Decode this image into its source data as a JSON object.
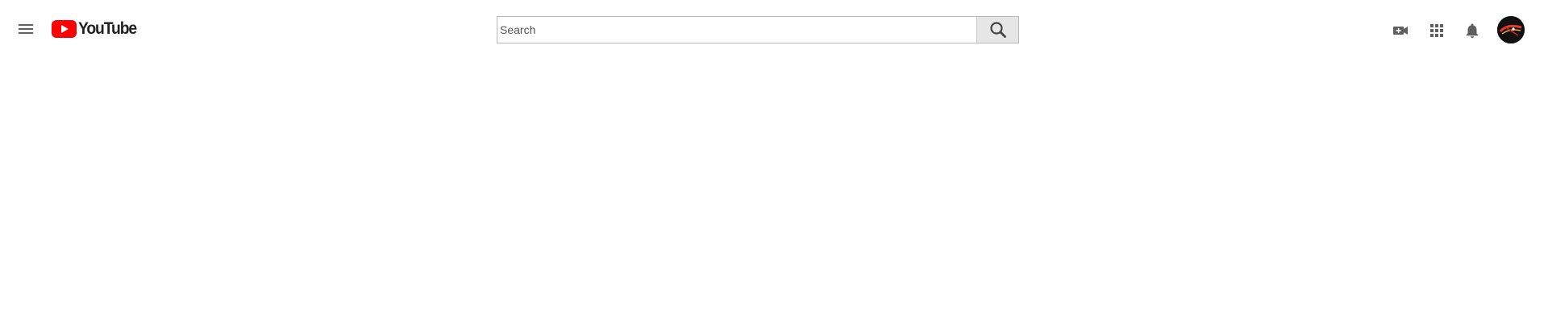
{
  "masthead": {
    "menu_icon": "hamburger-menu-icon",
    "logo": {
      "wordmark": "YouTube",
      "badge_color": "#ff0000",
      "text_color": "#212121"
    },
    "search": {
      "placeholder": "Search",
      "value": "",
      "button_icon": "search-icon"
    },
    "actions": [
      {
        "id": "create",
        "icon": "video-camera-add-icon"
      },
      {
        "id": "apps",
        "icon": "apps-grid-icon"
      },
      {
        "id": "notifications",
        "icon": "bell-icon"
      }
    ],
    "avatar": {
      "icon": "account-avatar",
      "accent_colors": [
        "#111111",
        "#e23b2b",
        "#f4a04b"
      ]
    }
  }
}
